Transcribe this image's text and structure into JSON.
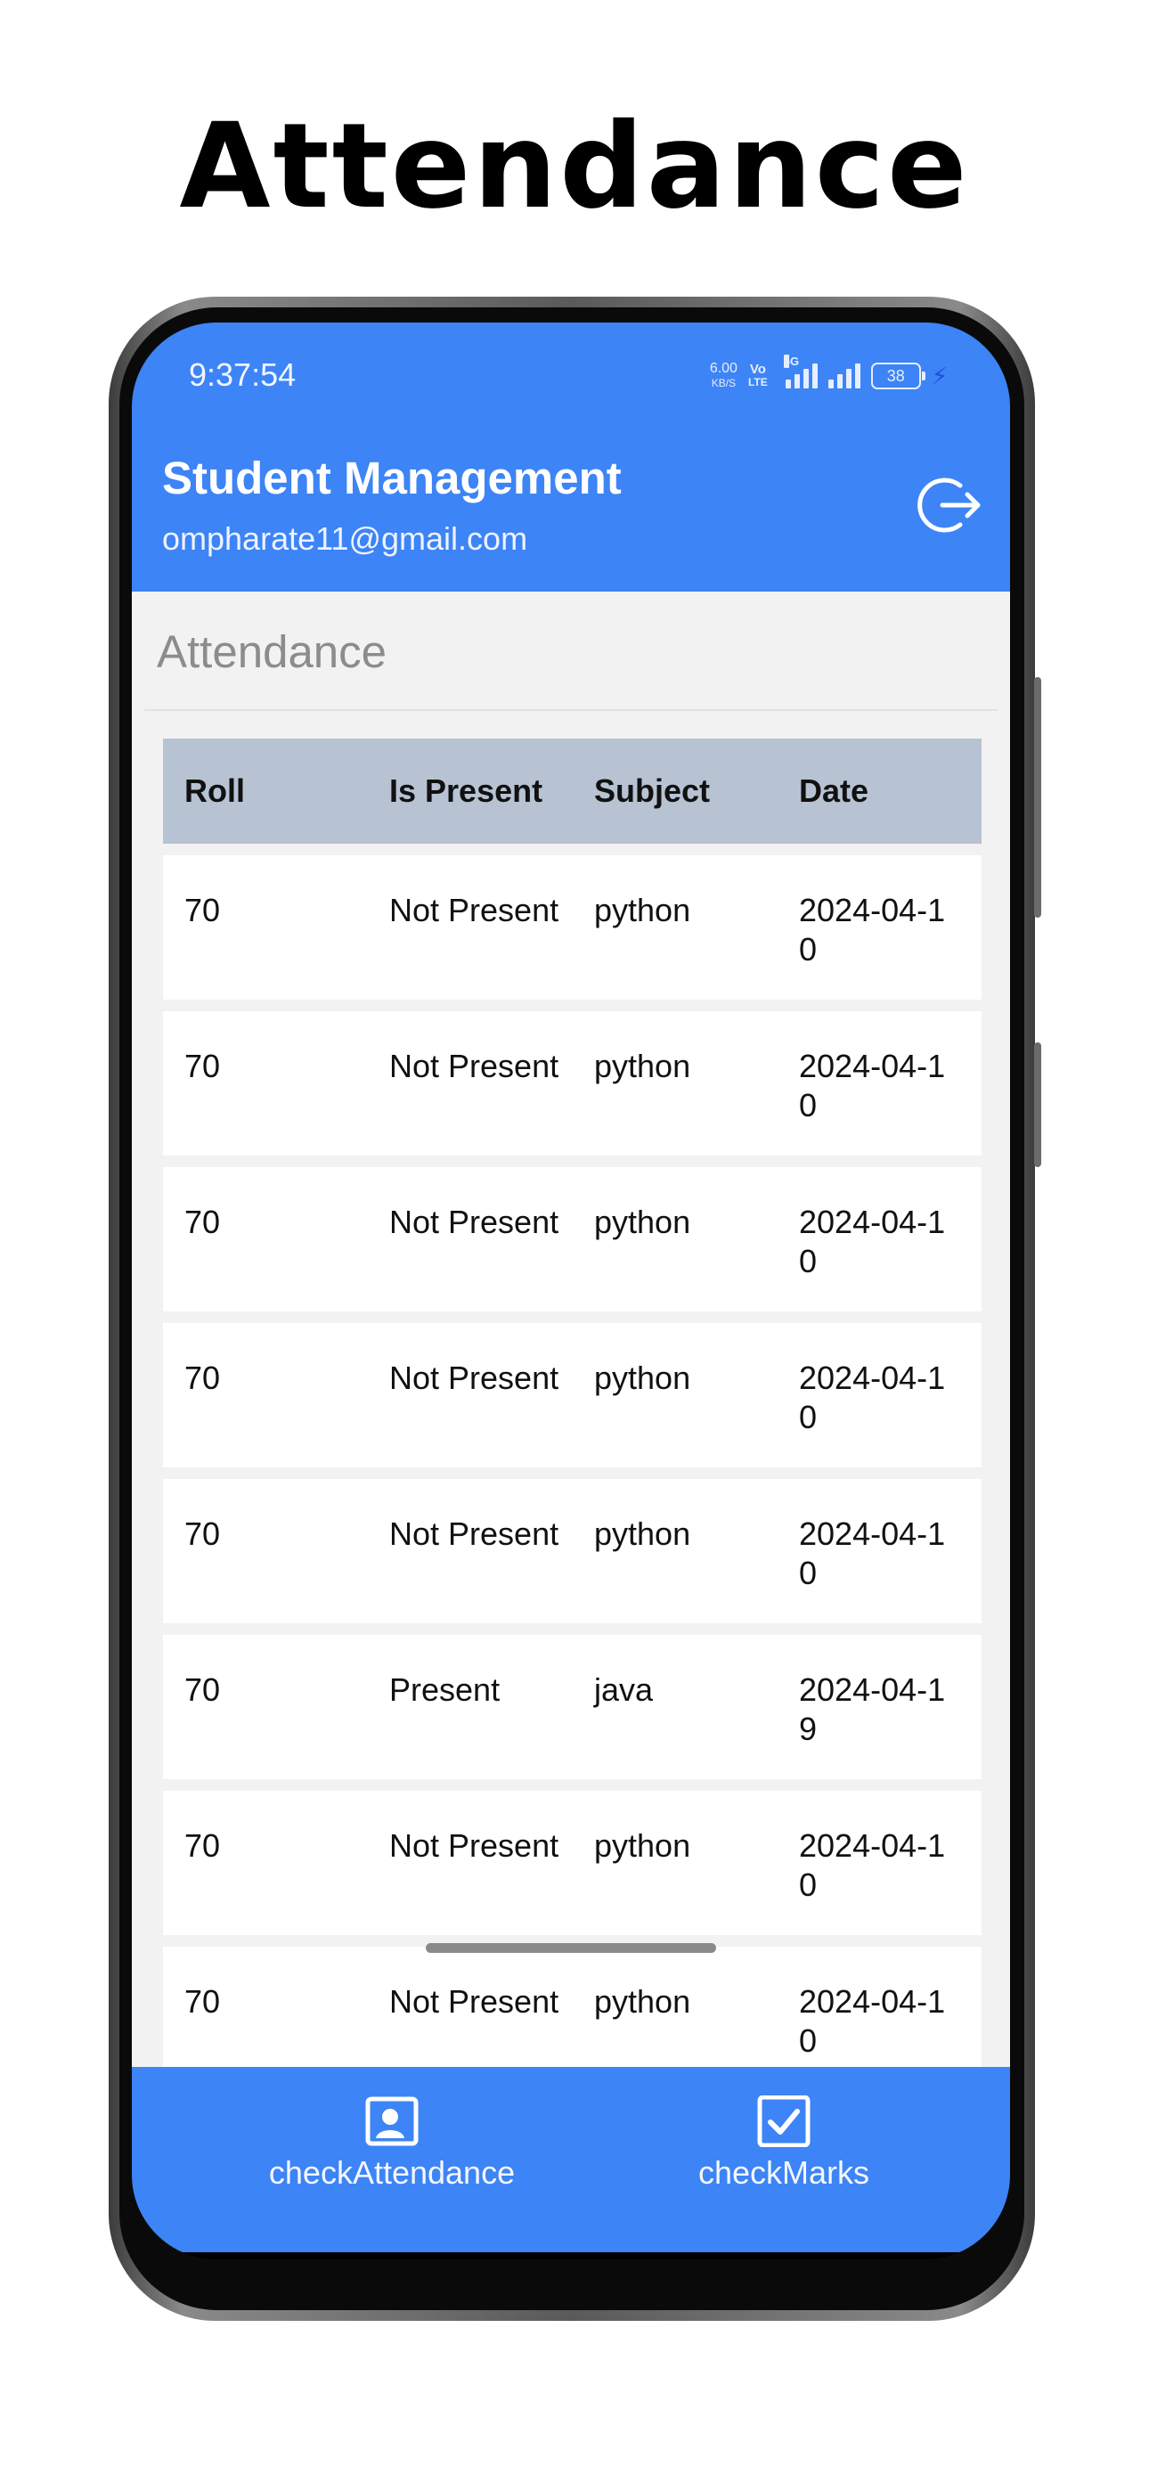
{
  "promo": {
    "title": "Attendance"
  },
  "status_bar": {
    "time": "9:37:54",
    "net_speed_value": "6.00",
    "net_speed_unit": "KB/S",
    "volte_top": "Vo",
    "volte_bottom": "LTE",
    "network": "5G",
    "battery": "38"
  },
  "app_bar": {
    "title": "Student Management",
    "email": "ompharate11@gmail.com",
    "logout_icon": "logout-icon"
  },
  "page": {
    "section_title": "Attendance"
  },
  "table": {
    "headers": [
      "Roll",
      "Is Present",
      "Subject",
      "Date"
    ],
    "rows": [
      {
        "roll": "70",
        "present": "Not Present",
        "subject": "python",
        "date": "2024-04-10"
      },
      {
        "roll": "70",
        "present": "Not Present",
        "subject": "python",
        "date": "2024-04-10"
      },
      {
        "roll": "70",
        "present": "Not Present",
        "subject": "python",
        "date": "2024-04-10"
      },
      {
        "roll": "70",
        "present": "Not Present",
        "subject": "python",
        "date": "2024-04-10"
      },
      {
        "roll": "70",
        "present": "Not Present",
        "subject": "python",
        "date": "2024-04-10"
      },
      {
        "roll": "70",
        "present": "Present",
        "subject": "java",
        "date": "2024-04-19"
      },
      {
        "roll": "70",
        "present": "Not Present",
        "subject": "python",
        "date": "2024-04-10"
      },
      {
        "roll": "70",
        "present": "Not Present",
        "subject": "python",
        "date": "2024-04-10"
      }
    ]
  },
  "bottom_nav": {
    "items": [
      {
        "label": "checkAttendance",
        "icon": "attendance-icon"
      },
      {
        "label": "checkMarks",
        "icon": "checkbox-icon"
      }
    ]
  },
  "colors": {
    "primary": "#3d84f6",
    "table_header": "#b7c3d3",
    "background": "#f2f2f2"
  }
}
